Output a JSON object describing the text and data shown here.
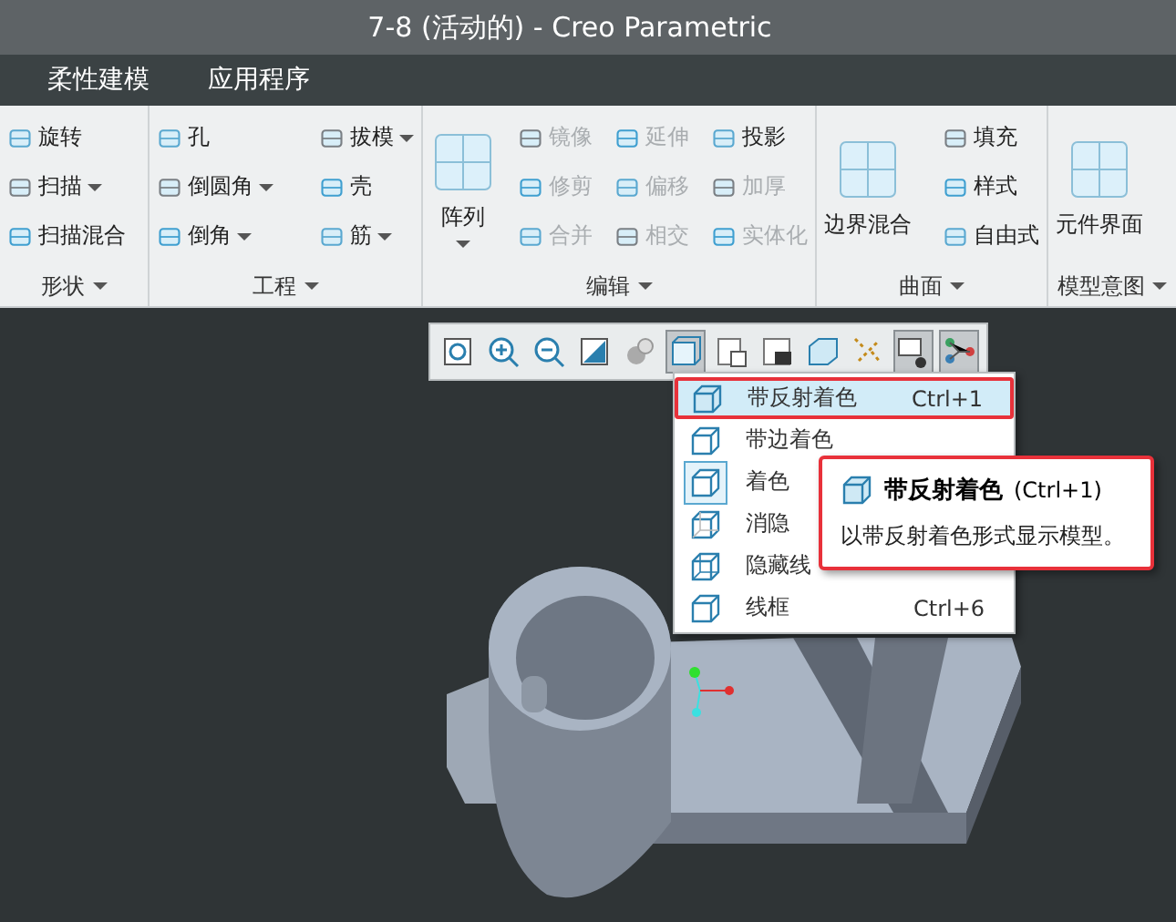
{
  "window": {
    "title": "7-8 (活动的) - Creo Parametric"
  },
  "menu_tabs": [
    {
      "label": "柔性建模"
    },
    {
      "label": "应用程序"
    }
  ],
  "ribbon": {
    "groups": [
      {
        "label": "形状",
        "columns": [
          {
            "kind": "small",
            "items": [
              {
                "label": "旋转",
                "dropdown": false,
                "disabled": false
              },
              {
                "label": "扫描",
                "dropdown": true,
                "disabled": false
              },
              {
                "label": "扫描混合",
                "dropdown": false,
                "disabled": false
              }
            ]
          }
        ]
      },
      {
        "label": "工程",
        "columns": [
          {
            "kind": "small",
            "items": [
              {
                "label": "孔",
                "dropdown": false,
                "disabled": false
              },
              {
                "label": "倒圆角",
                "dropdown": true,
                "disabled": false
              },
              {
                "label": "倒角",
                "dropdown": true,
                "disabled": false
              }
            ]
          },
          {
            "kind": "small",
            "items": [
              {
                "label": "拔模",
                "dropdown": true,
                "disabled": false
              },
              {
                "label": "壳",
                "dropdown": false,
                "disabled": false
              },
              {
                "label": "筋",
                "dropdown": true,
                "disabled": false
              }
            ]
          }
        ]
      },
      {
        "label": "编辑",
        "columns": [
          {
            "kind": "large",
            "label": "阵列",
            "dropdown": true
          },
          {
            "kind": "small",
            "items": [
              {
                "label": "镜像",
                "dropdown": false,
                "disabled": true
              },
              {
                "label": "修剪",
                "dropdown": false,
                "disabled": true
              },
              {
                "label": "合并",
                "dropdown": false,
                "disabled": true
              }
            ]
          },
          {
            "kind": "small",
            "items": [
              {
                "label": "延伸",
                "dropdown": false,
                "disabled": true
              },
              {
                "label": "偏移",
                "dropdown": false,
                "disabled": true
              },
              {
                "label": "相交",
                "dropdown": false,
                "disabled": true
              }
            ]
          },
          {
            "kind": "small",
            "items": [
              {
                "label": "投影",
                "dropdown": false,
                "disabled": false
              },
              {
                "label": "加厚",
                "dropdown": false,
                "disabled": true
              },
              {
                "label": "实体化",
                "dropdown": false,
                "disabled": true
              }
            ]
          }
        ]
      },
      {
        "label": "曲面",
        "columns": [
          {
            "kind": "large",
            "label": "边界混合",
            "dropdown": false
          },
          {
            "kind": "small",
            "items": [
              {
                "label": "填充",
                "dropdown": false,
                "disabled": false
              },
              {
                "label": "样式",
                "dropdown": false,
                "disabled": false
              },
              {
                "label": "自由式",
                "dropdown": false,
                "disabled": false
              }
            ]
          }
        ]
      },
      {
        "label": "模型意图",
        "columns": [
          {
            "kind": "large",
            "label": "元件界面",
            "dropdown": false
          }
        ]
      }
    ]
  },
  "view_toolbar": [
    {
      "selected": false
    },
    {
      "selected": false
    },
    {
      "selected": false
    },
    {
      "selected": false
    },
    {
      "selected": false
    },
    {
      "selected": true
    },
    {
      "selected": false
    },
    {
      "selected": false
    },
    {
      "selected": false
    },
    {
      "selected": false
    },
    {
      "selected": true
    },
    {
      "selected": true
    }
  ],
  "display_menu": {
    "items": [
      {
        "label": "带反射着色",
        "shortcut": "Ctrl+1",
        "selected": true,
        "checked": false
      },
      {
        "label": "带边着色",
        "selected": false,
        "checked": false
      },
      {
        "label": "着色",
        "selected": false,
        "checked": true
      },
      {
        "label": "消隐",
        "selected": false,
        "checked": false
      },
      {
        "label": "隐藏线",
        "selected": false,
        "checked": false
      },
      {
        "label": "线框",
        "shortcut": "Ctrl+6",
        "selected": false,
        "checked": false
      }
    ]
  },
  "tooltip": {
    "title": "带反射着色",
    "shortcut": "(Ctrl+1)",
    "description": "以带反射着色形式显示模型。"
  }
}
